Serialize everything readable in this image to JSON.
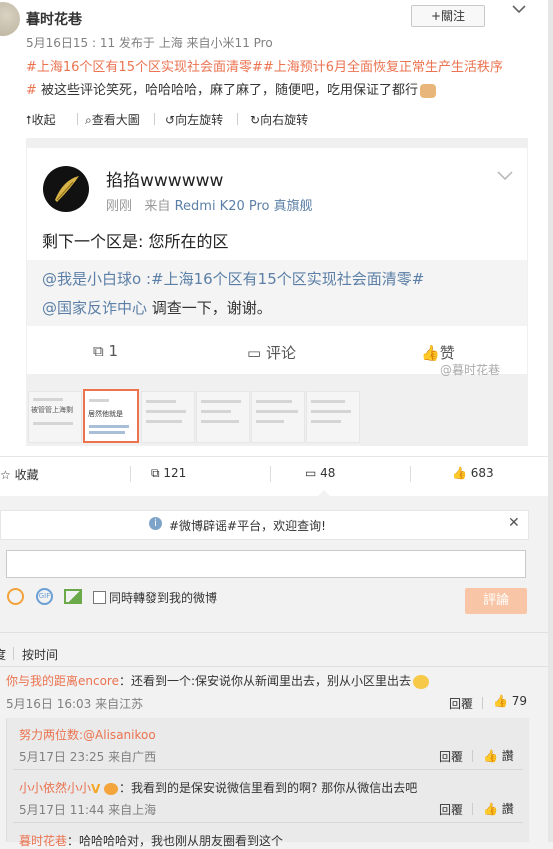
{
  "post": {
    "author": "暮时花巷",
    "meta": "5月16日15 : 11 发布于 上海 来自小米11 Pro",
    "follow_label": "+關注",
    "text_line1": "#上海16个区有15个区实现社会面清零##上海预计6月全面恢复正常生产生活秩序",
    "text_line2_tag": "#",
    "text_line2": " 被这些评论笑死，哈哈哈哈，麻了麻了，随便吧，吃用保证了都行",
    "tools": [
      "收起",
      "查看大圖",
      "向左旋转",
      "向右旋转"
    ]
  },
  "image": {
    "user": "掐掐wwwwww",
    "time": "刚刚",
    "from_label": "来自",
    "device": "Redmi K20 Pro 真旗舰",
    "content": "剩下一个区是: 您所在的区",
    "quote_line1": "@我是小白球o :#上海16个区有15个区实现社会面清零#",
    "quote_line2_link": "@国家反诈中心",
    "quote_line2_text": " 调查一下，谢谢。",
    "repost_count": "1",
    "comment_label": "评论",
    "like_label": "赞",
    "watermark": "@暮时花巷",
    "thumb_texts": [
      "被管管上海剩",
      "居然他就是"
    ]
  },
  "actions": {
    "fav": "收藏",
    "repost": "121",
    "comment": "48",
    "like": "683"
  },
  "notice": "#微博辟谣#平台，欢迎查询!",
  "composer": {
    "checkbox_label": "同時轉發到我的微博",
    "submit": "評論"
  },
  "sort": {
    "left_cut": "度",
    "by_time": "按时间"
  },
  "comments": [
    {
      "name": "你与我的距离encore",
      "text": "：还看到一个:保安说你从新闻里出去，别从小区里出去",
      "time": "5月16日 16:03 来自江苏",
      "reply": "回覆",
      "likes": "79"
    }
  ],
  "replies": [
    {
      "name": "努力两位数",
      "text": ":@Alisanikoo",
      "time": "5月17日 23:25 来自广西",
      "reply": "回覆",
      "like": "讚"
    },
    {
      "name": "小小依然小小",
      "text": "：我看到的是保安说微信里看到的啊? 那你从微信出去吧",
      "time": "5月17日 11:44 来自上海",
      "reply": "回覆",
      "like": "讚"
    },
    {
      "name": "暮时花巷",
      "text": "：哈哈哈哈对，我也刚从朋友圈看到这个",
      "time": "",
      "reply": "",
      "like": ""
    }
  ]
}
